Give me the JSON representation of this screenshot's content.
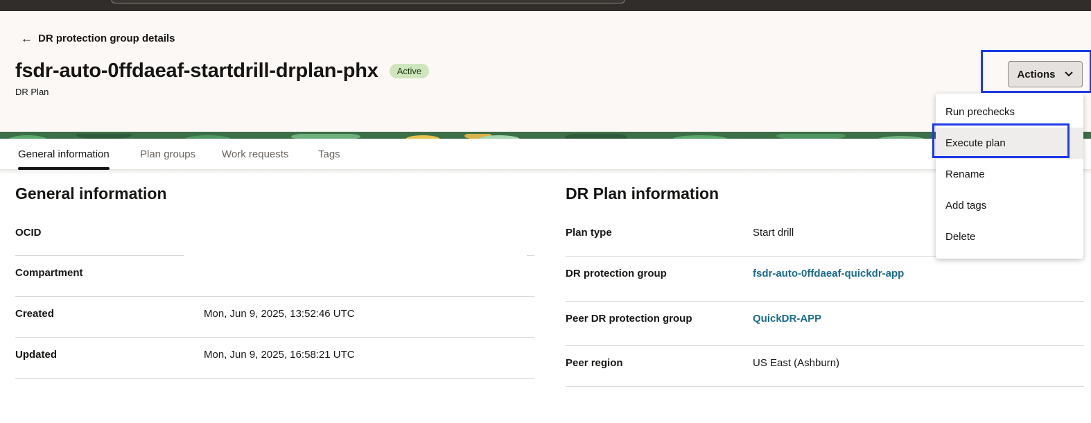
{
  "back_link": {
    "label": "DR protection group details"
  },
  "header": {
    "title": "fsdr-auto-0ffdaeaf-startdrill-drplan-phx",
    "status_badge": "Active",
    "subtitle": "DR Plan"
  },
  "actions": {
    "label": "Actions",
    "menu": [
      {
        "label": "Run prechecks"
      },
      {
        "label": "Execute plan",
        "highlighted": true
      },
      {
        "label": "Rename"
      },
      {
        "label": "Add tags"
      },
      {
        "label": "Delete"
      }
    ]
  },
  "tabs": [
    {
      "label": "General information",
      "active": true
    },
    {
      "label": "Plan groups"
    },
    {
      "label": "Work requests"
    },
    {
      "label": "Tags"
    }
  ],
  "general_information": {
    "title": "General information",
    "rows": [
      {
        "label": "OCID",
        "value": ""
      },
      {
        "label": "Compartment",
        "value": ""
      },
      {
        "label": "Created",
        "value": "Mon, Jun 9, 2025, 13:52:46 UTC"
      },
      {
        "label": "Updated",
        "value": "Mon, Jun 9, 2025, 16:58:21 UTC"
      }
    ]
  },
  "dr_plan_information": {
    "title": "DR Plan information",
    "rows": [
      {
        "label": "Plan type",
        "value": "Start drill"
      },
      {
        "label": "DR protection group",
        "value": "fsdr-auto-0ffdaeaf-quickdr-app"
      },
      {
        "label": "Peer DR protection group",
        "value": "QuickDR-APP"
      },
      {
        "label": "Peer region",
        "value": "US East (Ashburn)"
      }
    ]
  },
  "colors": {
    "accent_outline": "#1c39ea",
    "link": "#1b6b8c",
    "badge_bg": "#cfe5bd",
    "header_bg": "#fcf8f6"
  },
  "icons": {
    "back": "arrow-left-icon",
    "actions": "chevron-down-icon"
  }
}
